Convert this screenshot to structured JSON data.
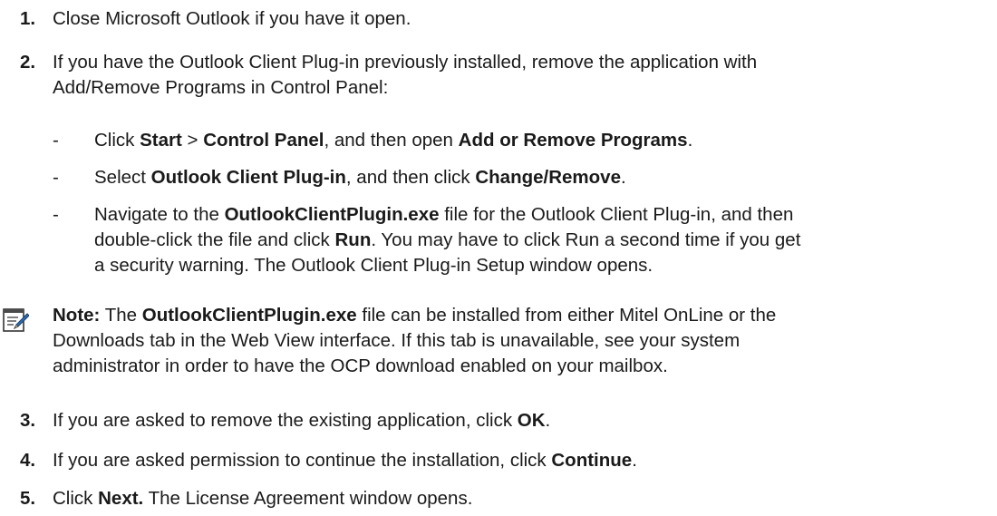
{
  "steps": [
    {
      "num": "1.",
      "text": "Close Microsoft Outlook if you have it open."
    },
    {
      "num": "2.",
      "text_line1": "If you have the Outlook Client Plug-in previously installed, remove the application with",
      "text_line2": "Add/Remove Programs in Control Panel:",
      "subitems": [
        {
          "dash": "-",
          "p1": "Click ",
          "b1": "Start",
          "p2": " > ",
          "b2": "Control Panel",
          "p3": ", and then open ",
          "b3": "Add or Remove Programs",
          "p4": "."
        },
        {
          "dash": "-",
          "p1": "Select ",
          "b1": "Outlook Client Plug-in",
          "p2": ", and then click ",
          "b2": "Change/Remove",
          "p3": "."
        },
        {
          "dash": "-",
          "p1": "Navigate to the ",
          "b1": "OutlookClientPlugin.exe",
          "p2": " file for the Outlook Client Plug-in, and then",
          "line2a": "double-click the file and click ",
          "line2b": "Run",
          "line2c": ". You may have to click Run a second time if you get",
          "line3": "a security warning. The Outlook Client Plug-in Setup window opens."
        }
      ]
    },
    {
      "num": "3.",
      "p1": "If you are asked to remove the existing application, click ",
      "b1": "OK",
      "p2": "."
    },
    {
      "num": "4.",
      "p1": "If you are asked permission to continue the installation, click ",
      "b1": "Continue",
      "p2": "."
    },
    {
      "num": "5.",
      "p1": "Click ",
      "b1": "Next.",
      "p2": " The License Agreement window opens."
    }
  ],
  "note": {
    "icon": "note-pencil-icon",
    "label": "Note:",
    "p1": " The ",
    "b1": "OutlookClientPlugin.exe",
    "p2": " file can be installed from either Mitel OnLine or the",
    "line2": "Downloads tab in the Web View interface. If this tab is unavailable, see your system",
    "line3": "administrator in order to have the OCP download enabled on your mailbox."
  }
}
